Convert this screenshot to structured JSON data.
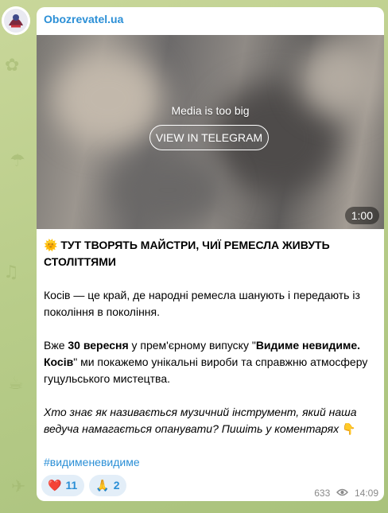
{
  "channel": {
    "name": "Obozrevatel.ua"
  },
  "media": {
    "notice": "Media is too big",
    "button_label": "VIEW IN TELEGRAM",
    "duration": "1:00"
  },
  "post": {
    "title_emoji": "🌞",
    "title": "ТУТ ТВОРЯТЬ МАЙСТРИ, ЧИЇ РЕМЕСЛА ЖИВУТЬ СТОЛІТТЯМИ",
    "paragraph1": "Косів — це край, де народні ремесла шанують і передають із покоління в покоління.",
    "p2_a": "Вже ",
    "p2_b": "30 вересня",
    "p2_c": " у прем'єрному випуску \"",
    "p2_d": "Видиме невидиме. Косів",
    "p2_e": "\" ми покажемо унікальні вироби та справжню атмосферу гуцульського мистецтва.",
    "paragraph3": "Хто знає як називається музичний інструмент, який наша ведуча намагається опанувати? Пишіть у коментарях",
    "paragraph3_emoji": "👇",
    "hashtag": "#видименевидиме"
  },
  "reactions": [
    {
      "emoji": "❤️",
      "count": "11"
    },
    {
      "emoji": "🙏",
      "count": "2"
    }
  ],
  "meta": {
    "views": "633",
    "time": "14:09"
  },
  "colors": {
    "link": "#2b8fd6",
    "background": "#b9cd8a"
  }
}
